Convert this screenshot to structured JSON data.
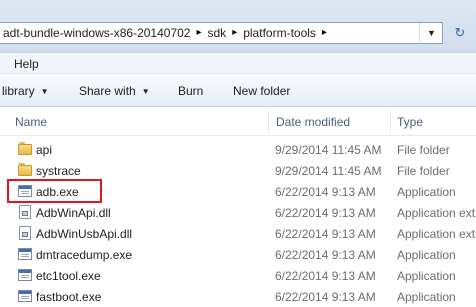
{
  "address_bar": {
    "crumbs": [
      "adt-bundle-windows-x86-20140702",
      "sdk",
      "platform-tools"
    ],
    "separator": "▸"
  },
  "menu": {
    "help": "Help"
  },
  "command_bar": {
    "library": "library",
    "share_with": "Share with",
    "burn": "Burn",
    "new_folder": "New folder"
  },
  "columns": {
    "name": "Name",
    "date_modified": "Date modified",
    "type": "Type"
  },
  "files": [
    {
      "name": "api",
      "date": "9/29/2014 11:45 AM",
      "type": "File folder",
      "icon": "folder-icon"
    },
    {
      "name": "systrace",
      "date": "9/29/2014 11:45 AM",
      "type": "File folder",
      "icon": "folder-icon"
    },
    {
      "name": "adb.exe",
      "date": "6/22/2014 9:13 AM",
      "type": "Application",
      "icon": "exe-icon"
    },
    {
      "name": "AdbWinApi.dll",
      "date": "6/22/2014 9:13 AM",
      "type": "Application ext",
      "icon": "dll-icon"
    },
    {
      "name": "AdbWinUsbApi.dll",
      "date": "6/22/2014 9:13 AM",
      "type": "Application ext",
      "icon": "dll-icon"
    },
    {
      "name": "dmtracedump.exe",
      "date": "6/22/2014 9:13 AM",
      "type": "Application",
      "icon": "exe-icon"
    },
    {
      "name": "etc1tool.exe",
      "date": "6/22/2014 9:13 AM",
      "type": "Application",
      "icon": "exe-icon"
    },
    {
      "name": "fastboot.exe",
      "date": "6/22/2014 9:13 AM",
      "type": "Application",
      "icon": "exe-icon"
    }
  ],
  "highlight": {
    "file": "adb.exe",
    "color": "#e0161b"
  }
}
